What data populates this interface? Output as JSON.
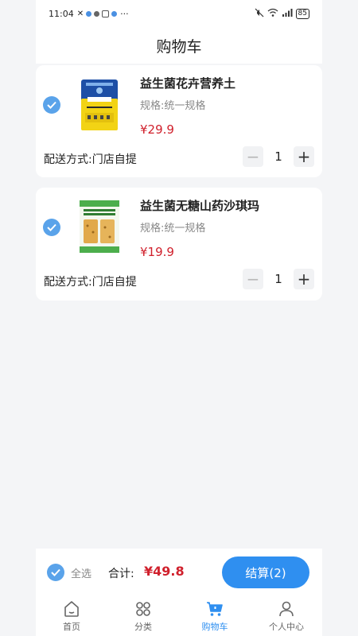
{
  "status_bar": {
    "time": "11:04",
    "extra": "···",
    "battery": "85"
  },
  "header": {
    "title": "购物车"
  },
  "cart_items": [
    {
      "title": "益生菌花卉营养土",
      "spec": "规格:统一规格",
      "price": "¥29.9",
      "delivery": "配送方式:门店自提",
      "quantity": "1",
      "checked": true,
      "image_icon": "soil-bag-image"
    },
    {
      "title": "益生菌无糖山药沙琪玛",
      "spec": "规格:统一规格",
      "price": "¥19.9",
      "delivery": "配送方式:门店自提",
      "quantity": "1",
      "checked": true,
      "image_icon": "snack-bag-image"
    }
  ],
  "stepper": {
    "minus": "−",
    "plus": "+"
  },
  "checkout": {
    "select_all_label": "全选",
    "total_label": "合计:",
    "total_value": "¥49.8",
    "button_label": "结算(2)"
  },
  "tabbar": {
    "tabs": [
      {
        "label": "首页",
        "icon": "home-icon",
        "active": false
      },
      {
        "label": "分类",
        "icon": "category-icon",
        "active": false
      },
      {
        "label": "购物车",
        "icon": "cart-icon",
        "active": true
      },
      {
        "label": "个人中心",
        "icon": "user-icon",
        "active": false
      }
    ]
  },
  "colors": {
    "accent": "#2f8ff0",
    "check": "#5aa3ea",
    "price": "#d0202c",
    "background": "#f4f5f7"
  }
}
